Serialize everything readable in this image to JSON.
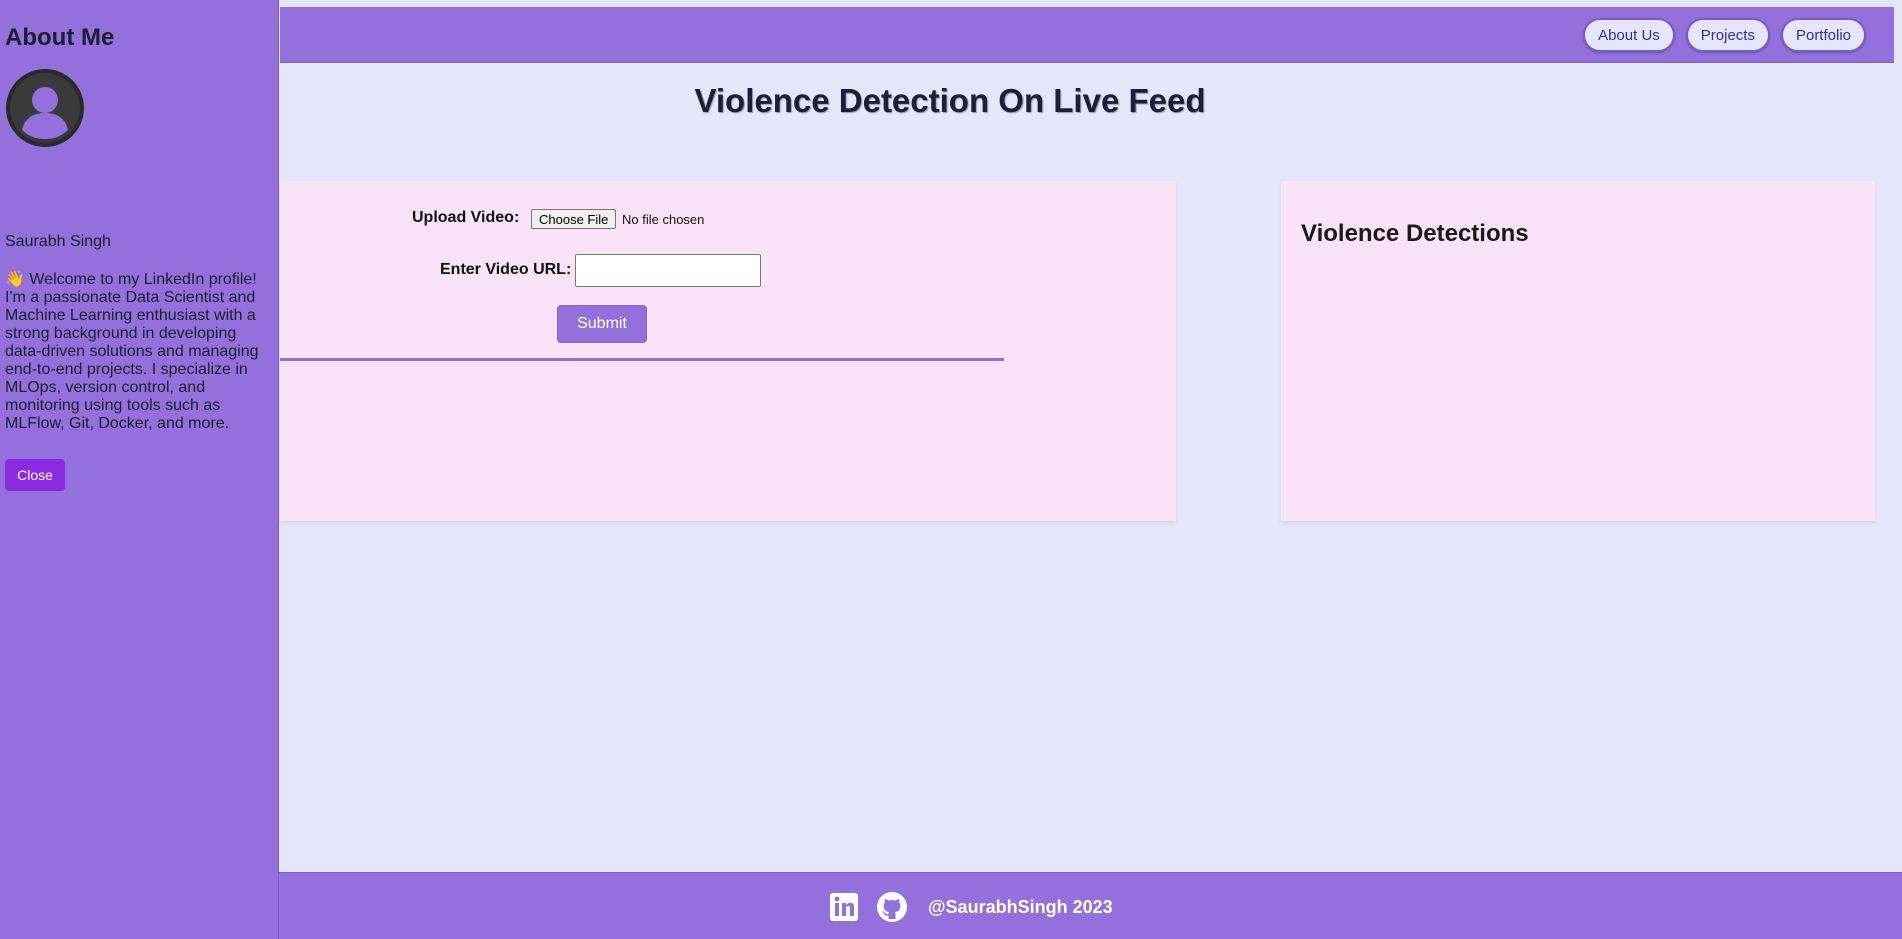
{
  "header": {
    "nav": [
      {
        "label": "About Us"
      },
      {
        "label": "Projects"
      },
      {
        "label": "Portfolio"
      }
    ]
  },
  "main": {
    "title": "Violence Detection On Live Feed",
    "upload": {
      "label": "Upload Video:",
      "button_label": "Choose File",
      "status": "No file chosen"
    },
    "url": {
      "label": "Enter Video URL:",
      "value": "",
      "placeholder": ""
    },
    "submit_label": "Submit",
    "detections_title": "Violence Detections"
  },
  "sidebar": {
    "title": "About Me",
    "avatar_icon": "user-avatar-icon",
    "name": "Saurabh Singh",
    "bio": "👋 Welcome to my LinkedIn profile! I'm a passionate Data Scientist and Machine Learning enthusiast with a strong background in developing data-driven solutions and managing end-to-end projects. I specialize in MLOps, version control, and monitoring using tools such as MLFlow, Git, Docker, and more.",
    "close_label": "Close"
  },
  "footer": {
    "icons": [
      "linkedin-icon",
      "github-icon"
    ],
    "text": "@SaurabhSingh 2023"
  },
  "colors": {
    "primary": "#9370db",
    "background": "#e6e6fa",
    "card": "#f9e3f7",
    "close_button": "#8a2be2"
  }
}
